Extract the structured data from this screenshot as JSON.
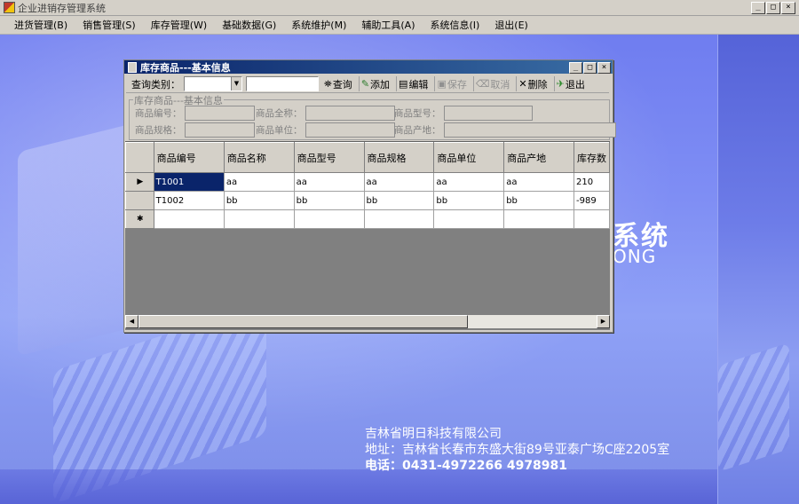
{
  "app": {
    "title": "企业进销存管理系统",
    "window_buttons": [
      "_",
      "□",
      "×"
    ]
  },
  "menu": [
    {
      "label": "进货管理(B)"
    },
    {
      "label": "销售管理(S)"
    },
    {
      "label": "库存管理(W)"
    },
    {
      "label": "基础数据(G)"
    },
    {
      "label": "系统维护(M)"
    },
    {
      "label": "辅助工具(A)"
    },
    {
      "label": "系统信息(I)"
    },
    {
      "label": "退出(E)"
    }
  ],
  "background": {
    "brand_cn": "系统",
    "brand_en": "ONG",
    "company_name": "吉林省明日科技有限公司",
    "address": "地址：吉林省长春市东盛大街89号亚泰广场C座2205室",
    "phone": "电话：0431-4972266  4978981"
  },
  "child_window": {
    "title": "库存商品---基本信息",
    "window_buttons": [
      "_",
      "□",
      "×"
    ],
    "toolbar": {
      "query_category_label": "查询类别：",
      "query_category_value": "",
      "query_text_value": "",
      "buttons": [
        {
          "label": "查询",
          "icon": "binoculars-icon",
          "enabled": true
        },
        {
          "label": "添加",
          "icon": "add-icon",
          "enabled": true
        },
        {
          "label": "编辑",
          "icon": "edit-icon",
          "enabled": true
        },
        {
          "label": "保存",
          "icon": "save-icon",
          "enabled": false
        },
        {
          "label": "取消",
          "icon": "cancel-icon",
          "enabled": false
        },
        {
          "label": "删除",
          "icon": "delete-icon",
          "enabled": true
        },
        {
          "label": "退出",
          "icon": "exit-icon",
          "enabled": true
        }
      ]
    },
    "groupbox": {
      "title": "库存商品---基本信息",
      "fields": [
        {
          "label": "商品编号：",
          "value": ""
        },
        {
          "label": "商品全称：",
          "value": ""
        },
        {
          "label": "商品型号：",
          "value": ""
        },
        {
          "label": "商品规格：",
          "value": ""
        },
        {
          "label": "商品单位：",
          "value": ""
        },
        {
          "label": "商品产地：",
          "value": ""
        }
      ]
    },
    "grid": {
      "columns": [
        "商品编号",
        "商品名称",
        "商品型号",
        "商品规格",
        "商品单位",
        "商品产地",
        "库存数"
      ],
      "rows": [
        {
          "marker": "▶",
          "cells": [
            "T1001",
            "aa",
            "aa",
            "aa",
            "aa",
            "aa",
            "210"
          ]
        },
        {
          "marker": "",
          "cells": [
            "T1002",
            "bb",
            "bb",
            "bb",
            "bb",
            "bb",
            "-989"
          ]
        },
        {
          "marker": "✱",
          "cells": [
            "",
            "",
            "",
            "",
            "",
            "",
            ""
          ]
        }
      ],
      "scroll_left": "◀",
      "scroll_right": "▶"
    }
  }
}
